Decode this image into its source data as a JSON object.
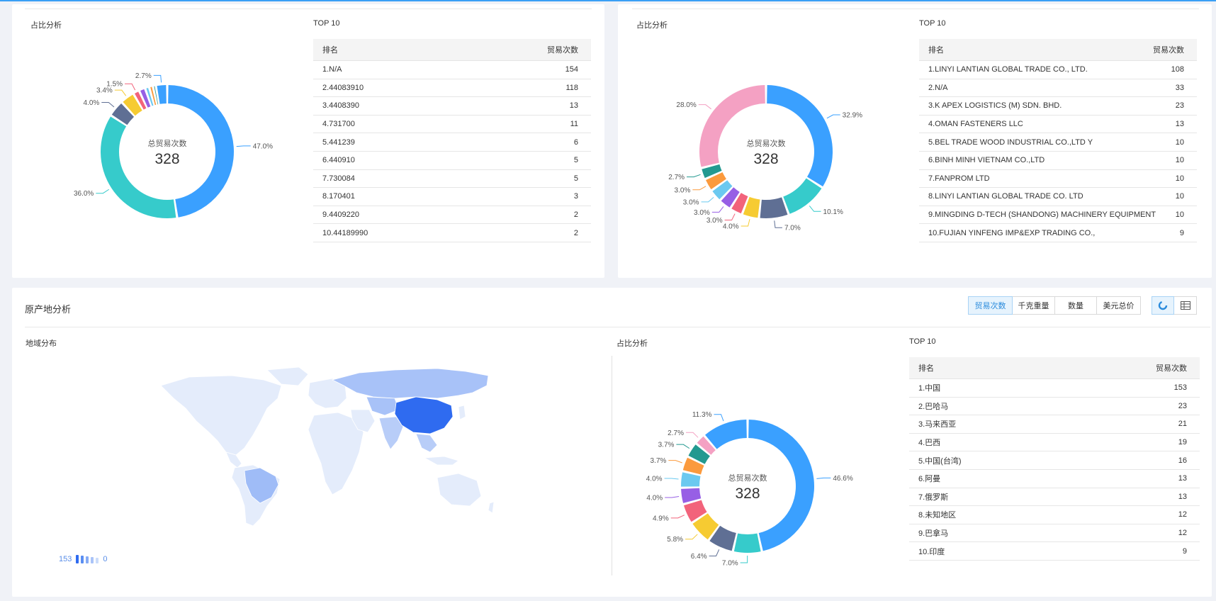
{
  "colors": {
    "accent": "#3a9ff5",
    "palette": [
      "#3aa0ff",
      "#36cbcb",
      "#5f6f94",
      "#f6cb32",
      "#f2637b",
      "#975fe5",
      "#6bc9f0",
      "#fb9a3d",
      "#239990",
      "#f4a1c3"
    ]
  },
  "top_left": {
    "pie_title": "占比分析",
    "center_label": "总贸易次数",
    "center_value": "328",
    "table_title": "TOP 10",
    "table_header": {
      "rank": "排名",
      "count": "贸易次数"
    },
    "rows": [
      {
        "name": "1.N/A",
        "value": "154"
      },
      {
        "name": "2.44083910",
        "value": "118"
      },
      {
        "name": "3.4408390",
        "value": "13"
      },
      {
        "name": "4.731700",
        "value": "11"
      },
      {
        "name": "5.441239",
        "value": "6"
      },
      {
        "name": "6.440910",
        "value": "5"
      },
      {
        "name": "7.730084",
        "value": "5"
      },
      {
        "name": "8.170401",
        "value": "3"
      },
      {
        "name": "9.4409220",
        "value": "2"
      },
      {
        "name": "10.44189990",
        "value": "2"
      }
    ]
  },
  "top_right": {
    "pie_title": "占比分析",
    "center_label": "总贸易次数",
    "center_value": "328",
    "table_title": "TOP 10",
    "table_header": {
      "rank": "排名",
      "count": "贸易次数"
    },
    "rows": [
      {
        "name": "1.LINYI LANTIAN GLOBAL TRADE CO., LTD.",
        "value": "108"
      },
      {
        "name": "2.N/A",
        "value": "33"
      },
      {
        "name": "3.K APEX LOGISTICS (M) SDN. BHD.",
        "value": "23"
      },
      {
        "name": "4.OMAN FASTENERS LLC",
        "value": "13"
      },
      {
        "name": "5.BEL TRADE WOOD INDUSTRIAL CO.,LTD Y",
        "value": "10"
      },
      {
        "name": "6.BINH MINH VIETNAM CO.,LTD",
        "value": "10"
      },
      {
        "name": "7.FANPROM LTD",
        "value": "10"
      },
      {
        "name": "8.LINYI LANTIAN GLOBAL TRADE CO. LTD",
        "value": "10"
      },
      {
        "name": "9.MINGDING D-TECH (SHANDONG) MACHINERY EQUIPMENT",
        "value": "10"
      },
      {
        "name": "10.FUJIAN YINFENG IMP&EXP TRADING CO.,",
        "value": "9"
      }
    ]
  },
  "origin": {
    "section_title": "原产地分析",
    "buttons": [
      "贸易次数",
      "千克重量",
      "数量",
      "美元总价"
    ],
    "active_button": 0,
    "view_icons": [
      "pie-chart-icon",
      "table-icon"
    ],
    "map_title": "地域分布",
    "legend_max": "153",
    "legend_min": "0",
    "pie_title": "占比分析",
    "center_label": "总贸易次数",
    "center_value": "328",
    "table_title": "TOP 10",
    "table_header": {
      "rank": "排名",
      "count": "贸易次数"
    },
    "rows": [
      {
        "name": "1.中国",
        "value": "153"
      },
      {
        "name": "2.巴哈马",
        "value": "23"
      },
      {
        "name": "3.马来西亚",
        "value": "21"
      },
      {
        "name": "4.巴西",
        "value": "19"
      },
      {
        "name": "5.中国(台湾)",
        "value": "16"
      },
      {
        "name": "6.阿曼",
        "value": "13"
      },
      {
        "name": "7.俄罗斯",
        "value": "13"
      },
      {
        "name": "8.未知地区",
        "value": "12"
      },
      {
        "name": "9.巴拿马",
        "value": "12"
      },
      {
        "name": "10.印度",
        "value": "9"
      }
    ]
  },
  "chart_data": [
    {
      "type": "pie",
      "title": "",
      "center_label": "总贸易次数",
      "total": 328,
      "slices": [
        {
          "value": 47.0,
          "label": "47.0%"
        },
        {
          "value": 36.0,
          "label": "36.0%"
        },
        {
          "value": 4.0,
          "label": "4.0%"
        },
        {
          "value": 3.4,
          "label": "3.4%"
        },
        {
          "value": 1.5,
          "label": "1.5%"
        },
        {
          "value": 1.5,
          "label": ""
        },
        {
          "value": 1.0,
          "label": ""
        },
        {
          "value": 0.9,
          "label": ""
        },
        {
          "value": 0.7,
          "label": ""
        },
        {
          "value": 2.7,
          "label": "2.7%"
        }
      ]
    },
    {
      "type": "pie",
      "title": "",
      "center_label": "总贸易次数",
      "total": 328,
      "slices": [
        {
          "value": 32.9,
          "label": "32.9%"
        },
        {
          "value": 10.1,
          "label": "10.1%"
        },
        {
          "value": 7.0,
          "label": "7.0%"
        },
        {
          "value": 4.0,
          "label": "4.0%"
        },
        {
          "value": 3.0,
          "label": "3.0%"
        },
        {
          "value": 3.0,
          "label": "3.0%"
        },
        {
          "value": 3.0,
          "label": "3.0%"
        },
        {
          "value": 3.0,
          "label": "3.0%"
        },
        {
          "value": 2.7,
          "label": "2.7%"
        },
        {
          "value": 28.0,
          "label": "28.0%"
        }
      ]
    },
    {
      "type": "pie",
      "title": "",
      "center_label": "总贸易次数",
      "total": 328,
      "slices": [
        {
          "value": 46.6,
          "label": "46.6%"
        },
        {
          "value": 7.0,
          "label": "7.0%"
        },
        {
          "value": 6.4,
          "label": "6.4%"
        },
        {
          "value": 5.8,
          "label": "5.8%"
        },
        {
          "value": 4.9,
          "label": "4.9%"
        },
        {
          "value": 4.0,
          "label": "4.0%"
        },
        {
          "value": 4.0,
          "label": "4.0%"
        },
        {
          "value": 3.7,
          "label": "3.7%"
        },
        {
          "value": 3.7,
          "label": "3.7%"
        },
        {
          "value": 2.7,
          "label": "2.7%"
        },
        {
          "value": 11.3,
          "label": "11.3%"
        }
      ]
    }
  ]
}
